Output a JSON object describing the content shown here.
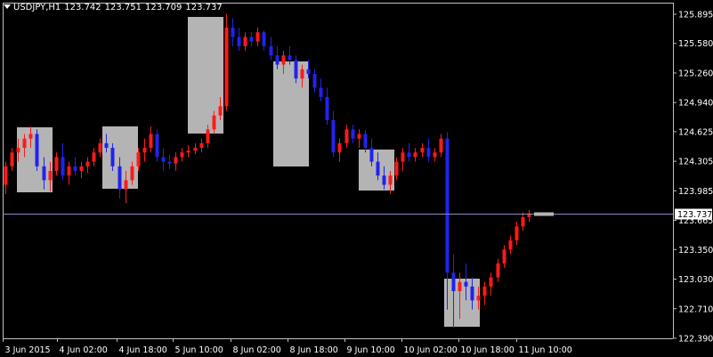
{
  "header": {
    "symbol": "USDJPY,H1",
    "open": "123.742",
    "high": "123.751",
    "low": "123.709",
    "close": "123.737"
  },
  "colors": {
    "background": "#000000",
    "bull": "#ff1a1a",
    "bear": "#2222ee",
    "box": "#b4b4b4",
    "axis": "#c0c0c0",
    "bid_line": "#8c8cc8",
    "price_label_bg": "#ffffff"
  },
  "current_price": "123.737",
  "chart_data": {
    "type": "candlestick",
    "title": "USDJPY,H1",
    "ylim": [
      122.39,
      126.0
    ],
    "y_ticks": [
      "125.895",
      "125.580",
      "125.260",
      "124.940",
      "124.625",
      "124.305",
      "123.985",
      "123.665",
      "123.350",
      "123.030",
      "122.710",
      "122.390"
    ],
    "x_ticks": [
      "3 Jun 2015",
      "4 Jun 02:00",
      "4 Jun 18:00",
      "5 Jun 10:00",
      "8 Jun 02:00",
      "8 Jun 18:00",
      "9 Jun 10:00",
      "10 Jun 02:00",
      "10 Jun 18:00",
      "11 Jun 10:00"
    ],
    "bars": [
      [
        124.05,
        124.3,
        123.95,
        124.25
      ],
      [
        124.25,
        124.45,
        124.2,
        124.4
      ],
      [
        124.4,
        124.55,
        124.3,
        124.45
      ],
      [
        124.45,
        124.6,
        124.35,
        124.55
      ],
      [
        124.55,
        124.68,
        124.45,
        124.6
      ],
      [
        124.6,
        124.65,
        124.2,
        124.25
      ],
      [
        124.25,
        124.35,
        124.0,
        124.1
      ],
      [
        124.1,
        124.3,
        123.98,
        124.2
      ],
      [
        124.2,
        124.4,
        124.15,
        124.35
      ],
      [
        124.35,
        124.5,
        124.1,
        124.15
      ],
      [
        124.15,
        124.3,
        124.05,
        124.25
      ],
      [
        124.25,
        124.35,
        124.15,
        124.2
      ],
      [
        124.2,
        124.3,
        124.12,
        124.25
      ],
      [
        124.25,
        124.35,
        124.18,
        124.3
      ],
      [
        124.3,
        124.45,
        124.25,
        124.4
      ],
      [
        124.4,
        124.55,
        124.35,
        124.5
      ],
      [
        124.5,
        124.6,
        124.4,
        124.45
      ],
      [
        124.45,
        124.5,
        124.2,
        124.25
      ],
      [
        124.25,
        124.35,
        123.9,
        124.0
      ],
      [
        124.0,
        124.2,
        123.85,
        124.1
      ],
      [
        124.1,
        124.3,
        124.05,
        124.25
      ],
      [
        124.25,
        124.45,
        124.2,
        124.4
      ],
      [
        124.4,
        124.55,
        124.3,
        124.45
      ],
      [
        124.45,
        124.68,
        124.4,
        124.6
      ],
      [
        124.6,
        124.65,
        124.3,
        124.35
      ],
      [
        124.35,
        124.45,
        124.2,
        124.3
      ],
      [
        124.3,
        124.38,
        124.22,
        124.28
      ],
      [
        124.28,
        124.4,
        124.2,
        124.35
      ],
      [
        124.35,
        124.45,
        124.3,
        124.4
      ],
      [
        124.4,
        124.48,
        124.35,
        124.42
      ],
      [
        124.42,
        124.5,
        124.38,
        124.45
      ],
      [
        124.45,
        124.55,
        124.4,
        124.5
      ],
      [
        124.5,
        124.7,
        124.45,
        124.65
      ],
      [
        124.65,
        124.85,
        124.6,
        124.8
      ],
      [
        124.8,
        125.0,
        124.75,
        124.9
      ],
      [
        124.9,
        125.9,
        124.85,
        125.75
      ],
      [
        125.75,
        125.85,
        125.55,
        125.65
      ],
      [
        125.65,
        125.75,
        125.5,
        125.55
      ],
      [
        125.55,
        125.7,
        125.5,
        125.65
      ],
      [
        125.65,
        125.7,
        125.55,
        125.6
      ],
      [
        125.6,
        125.75,
        125.55,
        125.7
      ],
      [
        125.7,
        125.72,
        125.5,
        125.55
      ],
      [
        125.55,
        125.65,
        125.4,
        125.45
      ],
      [
        125.45,
        125.55,
        125.3,
        125.35
      ],
      [
        125.35,
        125.5,
        125.25,
        125.45
      ],
      [
        125.45,
        125.55,
        125.35,
        125.4
      ],
      [
        125.4,
        125.45,
        125.15,
        125.2
      ],
      [
        125.2,
        125.35,
        125.1,
        125.3
      ],
      [
        125.3,
        125.4,
        125.2,
        125.25
      ],
      [
        125.25,
        125.3,
        125.05,
        125.1
      ],
      [
        125.1,
        125.2,
        124.95,
        125.0
      ],
      [
        125.0,
        125.1,
        124.7,
        124.75
      ],
      [
        124.75,
        124.85,
        124.35,
        124.4
      ],
      [
        124.4,
        124.55,
        124.3,
        124.5
      ],
      [
        124.5,
        124.7,
        124.45,
        124.65
      ],
      [
        124.65,
        124.7,
        124.5,
        124.55
      ],
      [
        124.55,
        124.65,
        124.45,
        124.6
      ],
      [
        124.6,
        124.65,
        124.4,
        124.45
      ],
      [
        124.45,
        124.55,
        124.25,
        124.3
      ],
      [
        124.3,
        124.4,
        124.1,
        124.15
      ],
      [
        124.15,
        124.25,
        124.0,
        124.05
      ],
      [
        124.05,
        124.2,
        123.95,
        124.15
      ],
      [
        124.15,
        124.35,
        124.1,
        124.3
      ],
      [
        124.3,
        124.45,
        124.2,
        124.4
      ],
      [
        124.4,
        124.5,
        124.3,
        124.35
      ],
      [
        124.35,
        124.45,
        124.3,
        124.4
      ],
      [
        124.4,
        124.5,
        124.35,
        124.45
      ],
      [
        124.45,
        124.55,
        124.3,
        124.35
      ],
      [
        124.35,
        124.45,
        124.3,
        124.4
      ],
      [
        124.4,
        124.6,
        124.35,
        124.55
      ],
      [
        124.55,
        124.62,
        122.7,
        123.1
      ],
      [
        123.1,
        123.3,
        122.5,
        122.9
      ],
      [
        122.9,
        123.1,
        122.6,
        123.0
      ],
      [
        123.0,
        123.2,
        122.8,
        122.95
      ],
      [
        122.95,
        123.05,
        122.7,
        122.8
      ],
      [
        122.8,
        122.95,
        122.7,
        122.85
      ],
      [
        122.85,
        123.0,
        122.75,
        122.95
      ],
      [
        122.95,
        123.1,
        122.85,
        123.05
      ],
      [
        123.05,
        123.25,
        123.0,
        123.2
      ],
      [
        123.2,
        123.4,
        123.15,
        123.35
      ],
      [
        123.35,
        123.5,
        123.3,
        123.45
      ],
      [
        123.45,
        123.65,
        123.4,
        123.6
      ],
      [
        123.6,
        123.75,
        123.55,
        123.7
      ],
      [
        123.7,
        123.78,
        123.65,
        123.74
      ]
    ]
  }
}
